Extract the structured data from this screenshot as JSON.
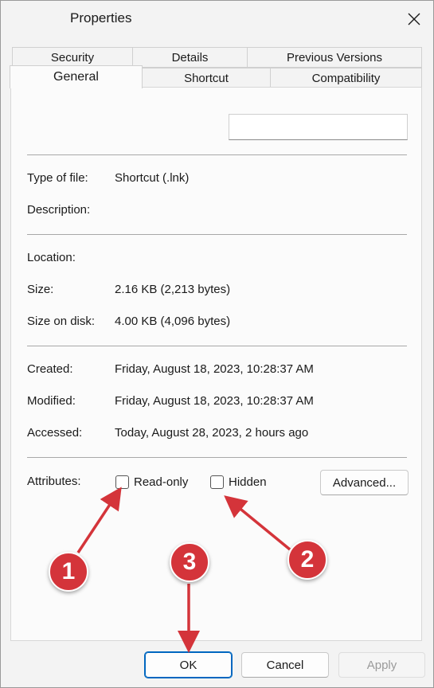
{
  "window": {
    "title": "Properties"
  },
  "tabs": {
    "row1": [
      "Security",
      "Details",
      "Previous Versions"
    ],
    "row2": [
      "General",
      "Shortcut",
      "Compatibility"
    ],
    "active": "General"
  },
  "general": {
    "name_value": "",
    "type_label": "Type of file:",
    "type_value": "Shortcut (.lnk)",
    "description_label": "Description:",
    "location_label": "Location:",
    "size_label": "Size:",
    "size_value": "2.16 KB (2,213 bytes)",
    "size_on_disk_label": "Size on disk:",
    "size_on_disk_value": "4.00 KB (4,096 bytes)",
    "created_label": "Created:",
    "created_value": "Friday, August 18, 2023, 10:28:37 AM",
    "modified_label": "Modified:",
    "modified_value": "Friday, August 18, 2023, 10:28:37 AM",
    "accessed_label": "Accessed:",
    "accessed_value": "Today, August 28, 2023, 2 hours ago",
    "attributes_label": "Attributes:",
    "readonly_label": "Read-only",
    "readonly_checked": false,
    "hidden_label": "Hidden",
    "hidden_checked": false,
    "advanced_label": "Advanced..."
  },
  "footer": {
    "ok_label": "OK",
    "cancel_label": "Cancel",
    "apply_label": "Apply"
  },
  "annotations": {
    "markers": [
      {
        "label": "1"
      },
      {
        "label": "2"
      },
      {
        "label": "3"
      }
    ],
    "color": "#d4343a"
  }
}
